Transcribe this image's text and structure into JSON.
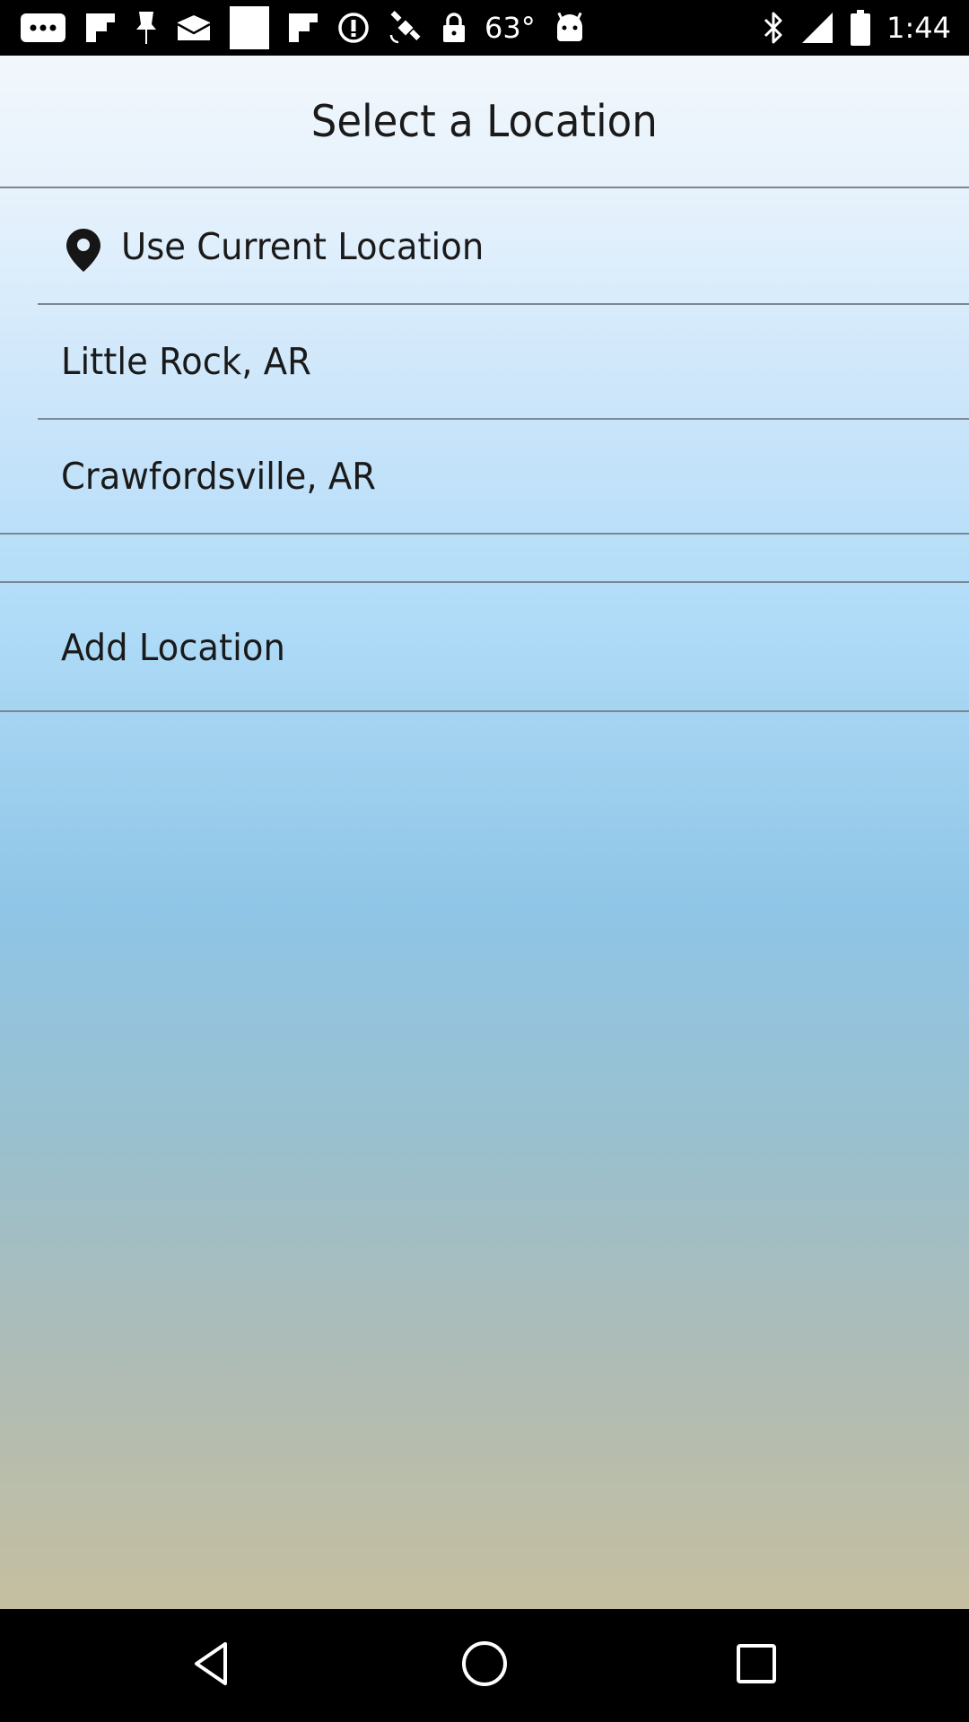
{
  "status_bar": {
    "left_icons": [
      "more-notifications-icon",
      "flipboard-icon",
      "pin-icon",
      "mail-icon",
      "blank-card-icon",
      "flipboard-icon",
      "info-circle-icon",
      "satellite-icon",
      "lock-icon"
    ],
    "temperature": "63°",
    "right_icons": [
      "android-icon",
      "bluetooth-icon",
      "signal-icon",
      "battery-icon"
    ],
    "time": "1:44"
  },
  "header": {
    "title": "Select a Location"
  },
  "locations": {
    "current": "Use Current Location",
    "items": [
      "Little Rock, AR",
      "Crawfordsville, AR"
    ],
    "add": "Add Location"
  },
  "nav_bar": {
    "icons": [
      "back-icon",
      "home-icon",
      "recents-icon"
    ]
  },
  "colors": {
    "status_bar_bg": "#000000",
    "gradient_top": "#f2f7fc",
    "gradient_mid": "#8fc5e6",
    "gradient_bottom": "#c5bf9f",
    "divider": "#7b8792",
    "text": "#1a1a1a"
  }
}
